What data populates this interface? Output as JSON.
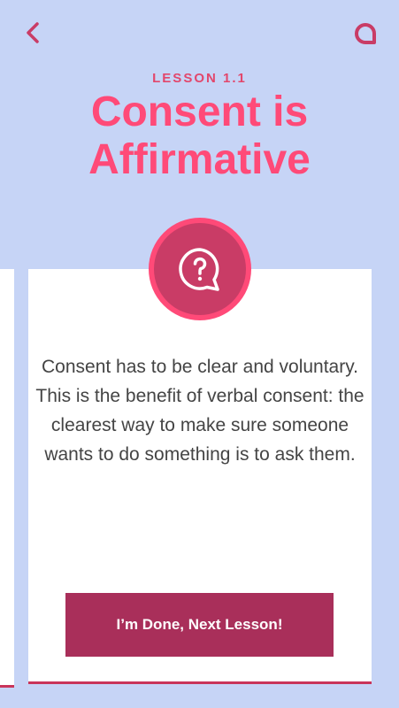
{
  "header": {
    "back_icon": "chevron-left-icon",
    "menu_icon": "chat-bubble-icon"
  },
  "lesson": {
    "label": "LESSON 1.1",
    "title_line1": "Consent is",
    "title_line2": "Affirmative"
  },
  "card": {
    "icon": "question-speech-bubble-icon",
    "text": "Consent has to be clear and voluntary. This is the benefit of verbal consent: the clearest way to make sure someone wants to do something is to ask them.",
    "button_label": "I’m Done, Next Lesson!"
  },
  "colors": {
    "background": "#c6d4f6",
    "accent_pink": "#ff4a78",
    "label_pink": "#e2476c",
    "button": "#a92f5a",
    "card_border": "#c9345a"
  }
}
